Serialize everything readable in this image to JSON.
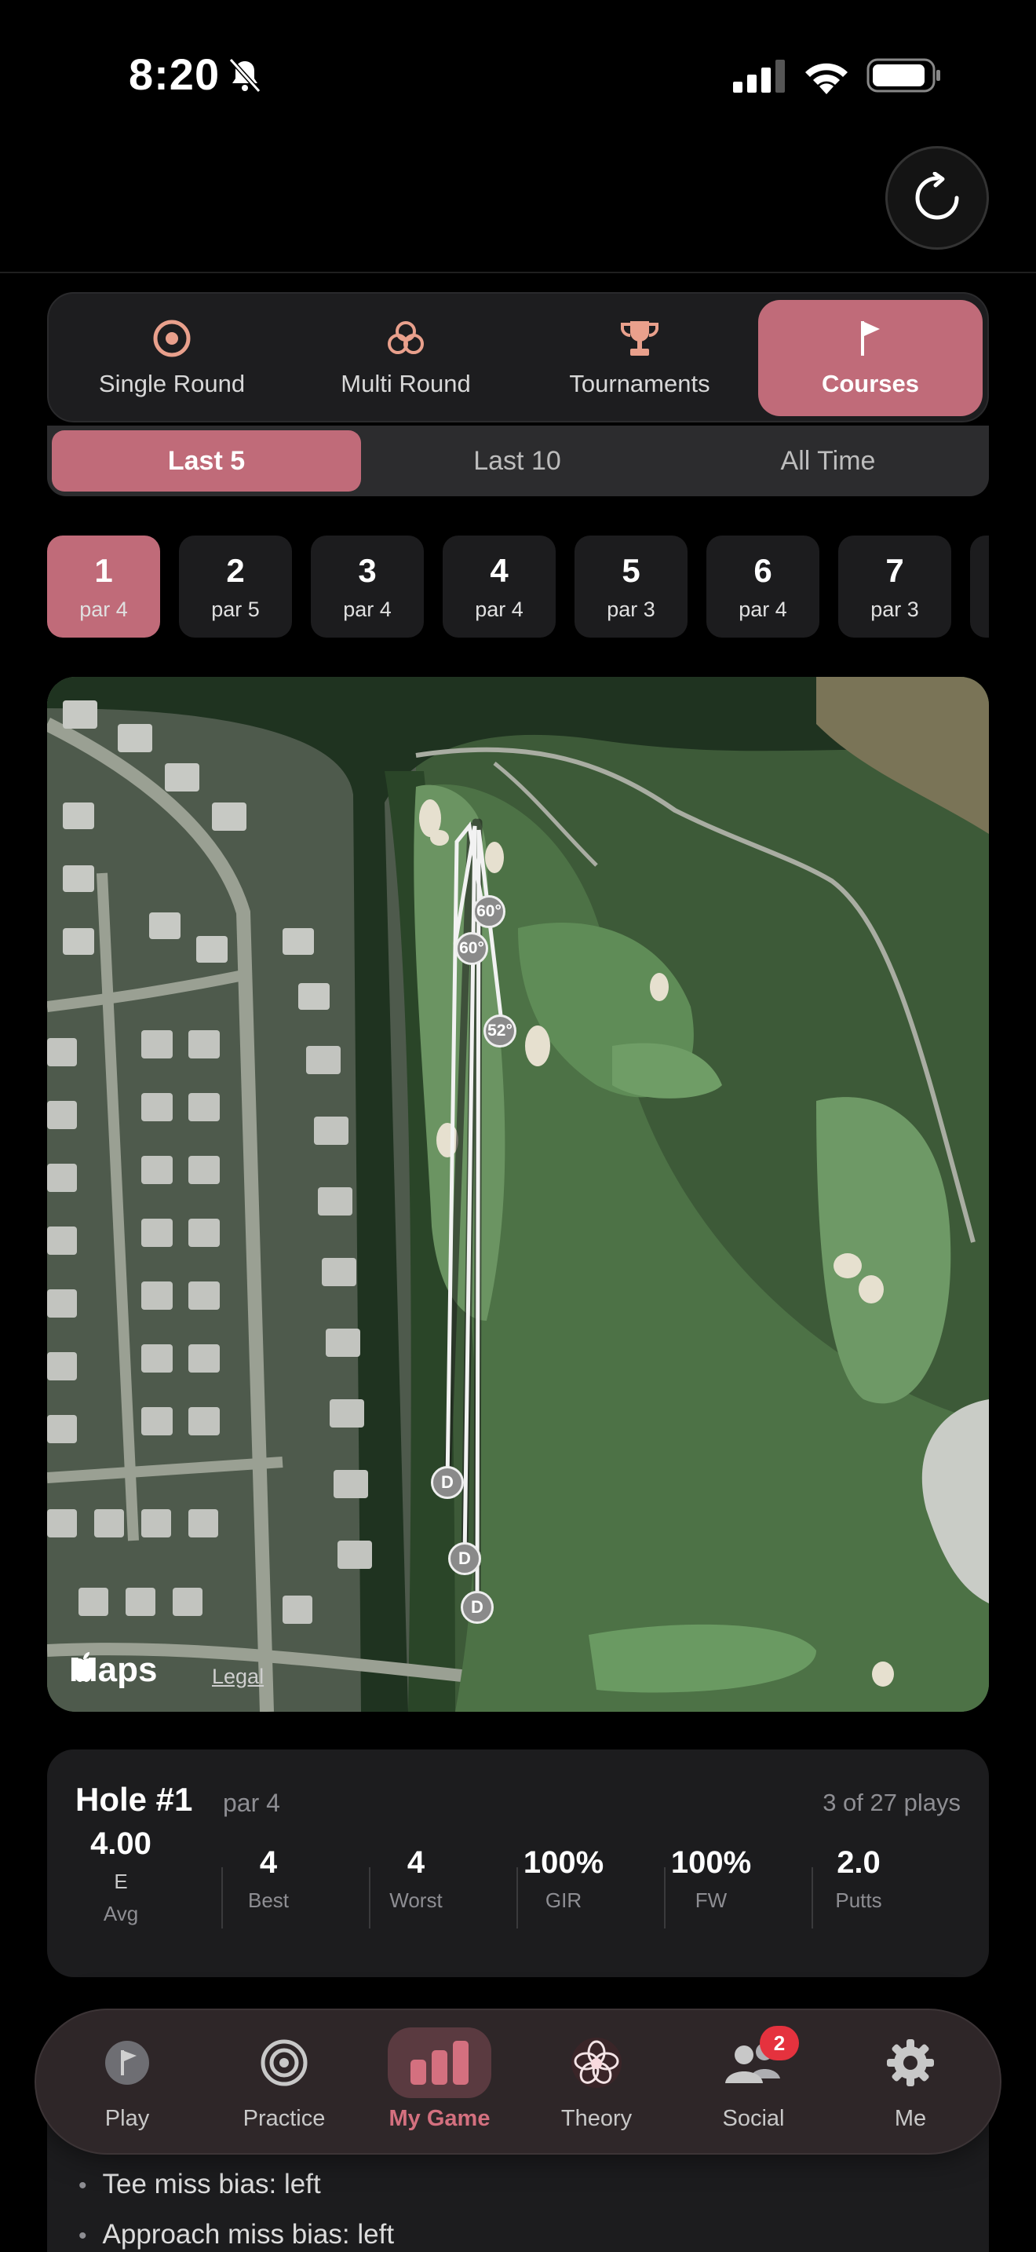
{
  "status_bar": {
    "time": "8:20"
  },
  "header": {
    "refresh_icon": "refresh-icon"
  },
  "mode_tabs": [
    {
      "label": "Single Round",
      "icon": "target-icon"
    },
    {
      "label": "Multi Round",
      "icon": "rings-icon"
    },
    {
      "label": "Tournaments",
      "icon": "trophy-icon"
    },
    {
      "label": "Courses",
      "icon": "flag-icon",
      "active": true
    }
  ],
  "range_tabs": [
    {
      "label": "Last 5",
      "active": true
    },
    {
      "label": "Last 10"
    },
    {
      "label": "All Time"
    }
  ],
  "holes": [
    {
      "number": "1",
      "par": "par 4",
      "active": true
    },
    {
      "number": "2",
      "par": "par 5"
    },
    {
      "number": "3",
      "par": "par 4"
    },
    {
      "number": "4",
      "par": "par 4"
    },
    {
      "number": "5",
      "par": "par 3"
    },
    {
      "number": "6",
      "par": "par 4"
    },
    {
      "number": "7",
      "par": "par 3"
    }
  ],
  "map": {
    "shot_markers": [
      "60°",
      "60°",
      "52°",
      "D",
      "D",
      "D"
    ],
    "logo": "Maps",
    "legal": "Legal"
  },
  "hole_card": {
    "title": "Hole #1",
    "par": "par 4",
    "plays": "3 of 27 plays",
    "stats": [
      {
        "value": "4.00",
        "sub": "E",
        "label": "Avg"
      },
      {
        "value": "4",
        "label": "Best"
      },
      {
        "value": "4",
        "label": "Worst"
      },
      {
        "value": "100%",
        "label": "GIR"
      },
      {
        "value": "100%",
        "label": "FW"
      },
      {
        "value": "2.0",
        "label": "Putts"
      }
    ]
  },
  "insights": [
    "Tee miss bias: left",
    "Approach miss bias: left"
  ],
  "tab_bar": [
    {
      "label": "Play",
      "icon": "flag-circle-icon"
    },
    {
      "label": "Practice",
      "icon": "target-icon"
    },
    {
      "label": "My Game",
      "icon": "bar-chart-icon",
      "active": true
    },
    {
      "label": "Theory",
      "icon": "flower-icon"
    },
    {
      "label": "Social",
      "icon": "people-icon",
      "badge": "2"
    },
    {
      "label": "Me",
      "icon": "gear-icon"
    }
  ],
  "colors": {
    "accent": "#c06b79",
    "active_tab_label": "#d4707f",
    "badge": "#e5323e"
  }
}
